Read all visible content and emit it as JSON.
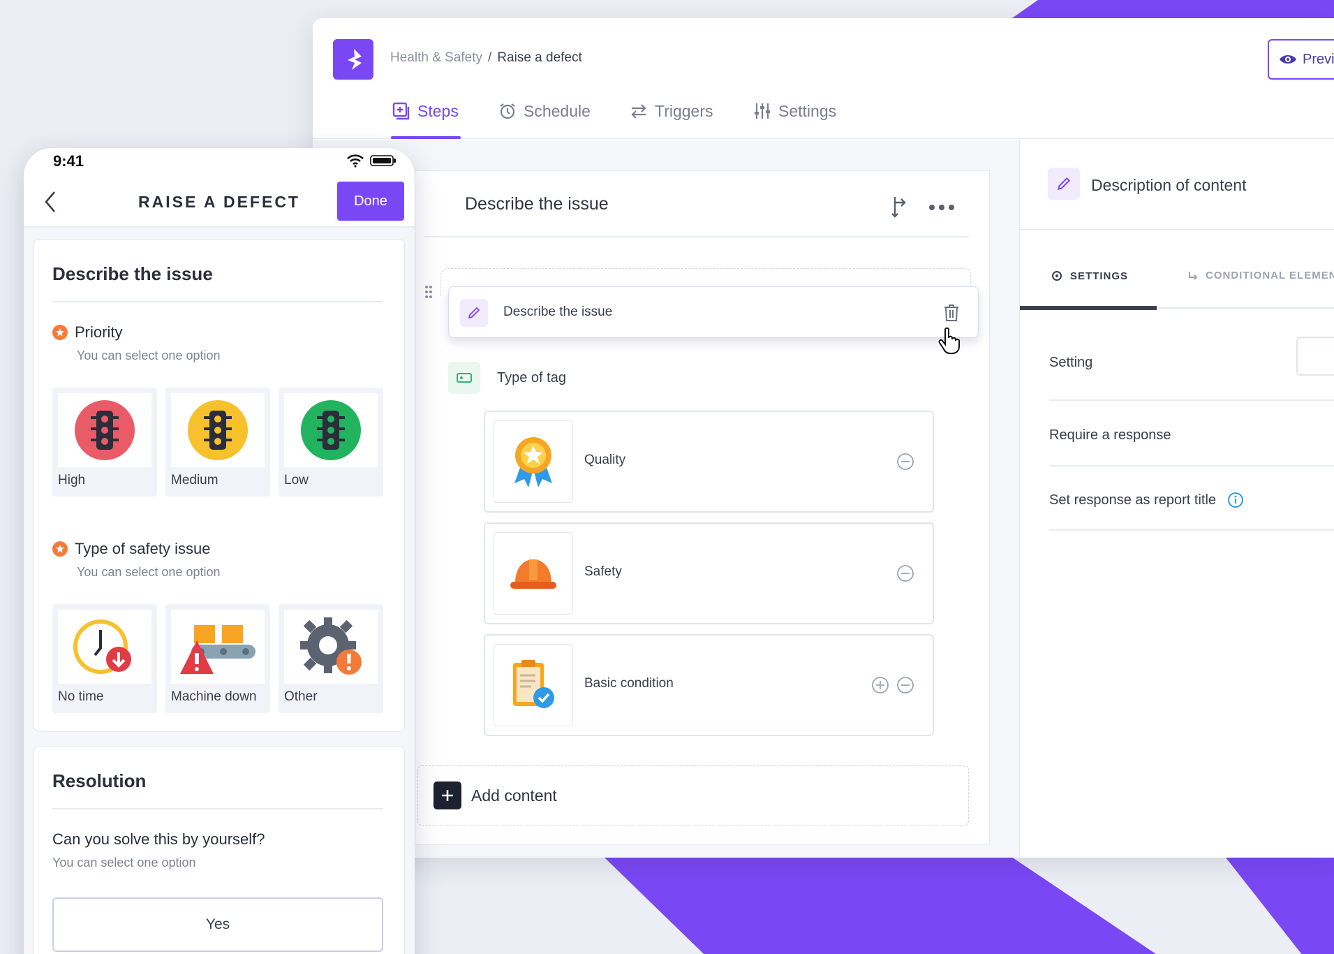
{
  "desktop": {
    "breadcrumb": {
      "parent": "Health & Safety",
      "separator": "/",
      "current": "Raise a defect"
    },
    "preview_label": "Previ",
    "tabs": [
      {
        "label": "Steps",
        "icon": "steps-icon",
        "active": true
      },
      {
        "label": "Schedule",
        "icon": "alarm-clock-icon"
      },
      {
        "label": "Triggers",
        "icon": "swap-arrows-icon"
      },
      {
        "label": "Settings",
        "icon": "sliders-icon"
      }
    ],
    "editor": {
      "step_title": "Describe the issue",
      "dragged_item": "Describe the issue",
      "tag_label": "Type of tag",
      "options": [
        {
          "label": "Quality",
          "icon": "award-ribbon-icon"
        },
        {
          "label": "Safety",
          "icon": "hard-hat-icon"
        },
        {
          "label": "Basic condition",
          "icon": "checklist-clipboard-icon"
        }
      ],
      "add_content": "Add content"
    },
    "panel": {
      "title": "Description of content",
      "tab_settings": "SETTINGS",
      "tab_conditional": "CONDITIONAL ELEMEN",
      "rows": {
        "setting": "Setting",
        "require": "Require a response",
        "report_title": "Set response as report title"
      }
    }
  },
  "phone": {
    "time": "9:41",
    "title": "RAISE A DEFECT",
    "done": "Done",
    "card1": {
      "title": "Describe the issue",
      "q1": {
        "label": "Priority",
        "sub": "You can select one option",
        "options": [
          {
            "label": "High",
            "color": "#ea5b68"
          },
          {
            "label": "Medium",
            "color": "#f6c12c"
          },
          {
            "label": "Low",
            "color": "#22b35e"
          }
        ]
      },
      "q2": {
        "label": "Type of safety issue",
        "sub": "You can select one option",
        "options": [
          {
            "label": "No time",
            "icon": "clock-down-icon"
          },
          {
            "label": "Machine down",
            "icon": "conveyor-warning-icon"
          },
          {
            "label": "Other",
            "icon": "gear-alert-icon"
          }
        ]
      }
    },
    "card2": {
      "title": "Resolution",
      "question": "Can you solve this by yourself?",
      "sub": "You can select one option",
      "yes": "Yes"
    }
  },
  "colors": {
    "accent": "#7a47f5",
    "warning": "#f57a3a",
    "info": "#2f9be8"
  }
}
